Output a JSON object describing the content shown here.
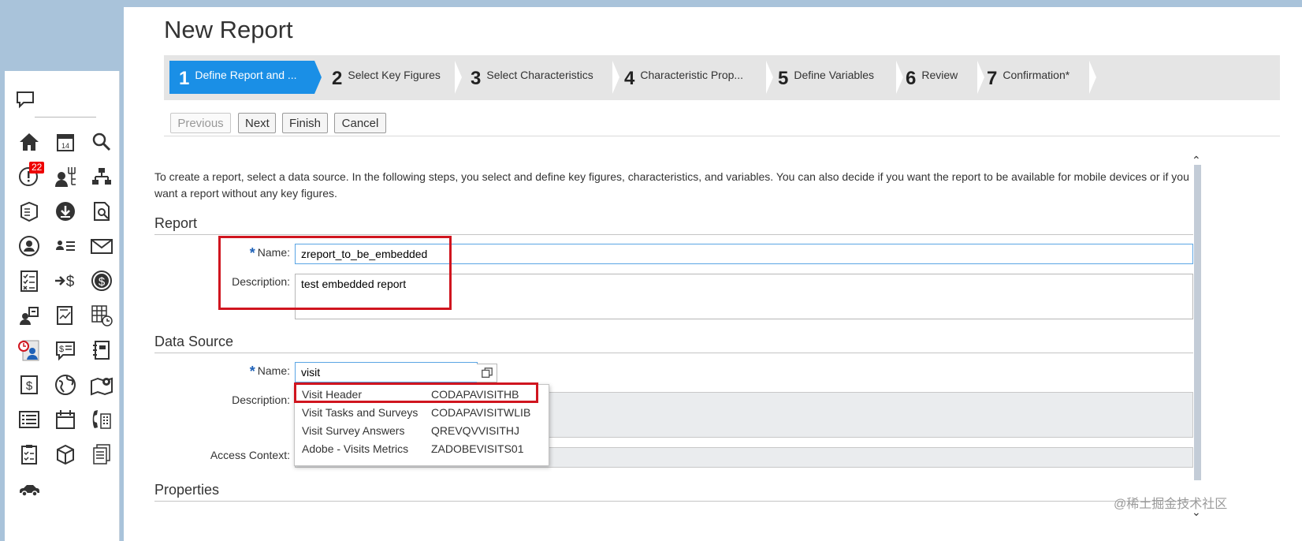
{
  "page": {
    "title": "New Report"
  },
  "sidebar": {
    "notification_badge": "22"
  },
  "roadmap": {
    "steps": [
      {
        "num": "1",
        "label": "Define Report and ..."
      },
      {
        "num": "2",
        "label": "Select Key Figures"
      },
      {
        "num": "3",
        "label": "Select Characteristics"
      },
      {
        "num": "4",
        "label": "Characteristic Prop..."
      },
      {
        "num": "5",
        "label": "Define Variables"
      },
      {
        "num": "6",
        "label": "Review"
      },
      {
        "num": "7",
        "label": "Confirmation*"
      }
    ]
  },
  "toolbar": {
    "previous": "Previous",
    "next": "Next",
    "finish": "Finish",
    "cancel": "Cancel"
  },
  "intro": "To create a report, select a data source. In the following steps, you select and define key figures, characteristics, and variables. You can also decide if you want the report to be available for mobile devices or if you want a report without any key figures.",
  "report": {
    "section": "Report",
    "name_label": "Name:",
    "name_value": "zreport_to_be_embedded",
    "desc_label": "Description:",
    "desc_value": "test embedded report"
  },
  "datasource": {
    "section": "Data Source",
    "name_label": "Name:",
    "name_value": "visit",
    "desc_label": "Description:",
    "access_label": "Access Context:",
    "suggestions": [
      {
        "name": "Visit Header",
        "id": "CODAPAVISITHB"
      },
      {
        "name": "Visit Tasks and Surveys",
        "id": "CODAPAVISITWLIB"
      },
      {
        "name": "Visit Survey Answers",
        "id": "QREVQVVISITHJ"
      },
      {
        "name": "Adobe - Visits Metrics",
        "id": "ZADOBEVISITS01"
      }
    ]
  },
  "properties": {
    "section": "Properties"
  },
  "watermark": "@稀土掘金技术社区",
  "colors": {
    "accent": "#1a8fe6",
    "highlight": "#d0151f",
    "required": "#1f62b8"
  }
}
